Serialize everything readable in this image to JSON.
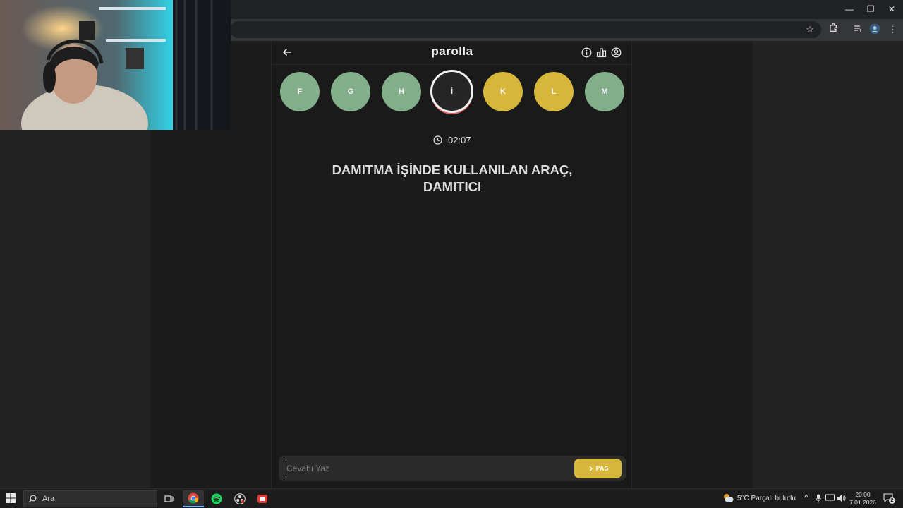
{
  "app": {
    "title": "parolla",
    "letters": [
      {
        "letter": "F",
        "state": "correct"
      },
      {
        "letter": "G",
        "state": "correct"
      },
      {
        "letter": "H",
        "state": "correct"
      },
      {
        "letter": "İ",
        "state": "current"
      },
      {
        "letter": "K",
        "state": "passed"
      },
      {
        "letter": "L",
        "state": "passed"
      },
      {
        "letter": "M",
        "state": "correct"
      }
    ],
    "timer": "02:07",
    "question": "DAMITMA İŞİNDE KULLANILAN ARAÇ, DAMITICI",
    "answer_placeholder": "Cevabı Yaz",
    "answer_value": "",
    "pass_label": "PAS"
  },
  "colors": {
    "correct": "#82ae8a",
    "passed": "#d6b73c",
    "current_ring": "#f2f2f2",
    "current_accent": "#e06161",
    "background": "#1a1a1a"
  },
  "taskbar": {
    "search_label": "Ara",
    "apps": [
      "task-view-icon",
      "chrome-icon",
      "spotify-icon",
      "obs-icon",
      "app-icon"
    ],
    "weather": "5°C  Parçalı bulutlu",
    "time": "20:00",
    "date": "7.01.2026",
    "notification_count": "2"
  }
}
